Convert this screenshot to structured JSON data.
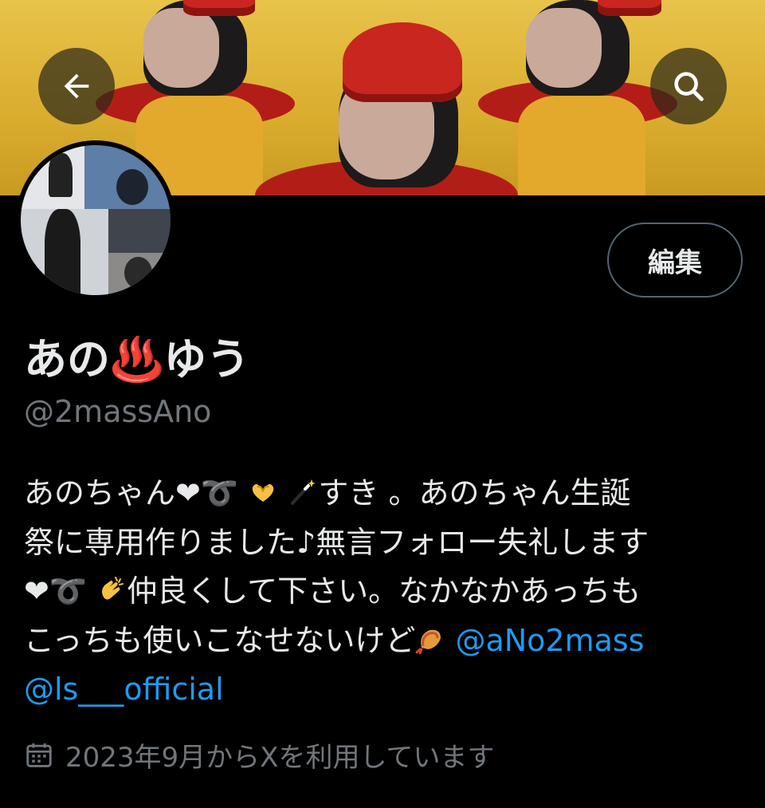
{
  "header": {
    "back_icon": "arrow-left-icon",
    "search_icon": "search-icon",
    "edit_label": "編集"
  },
  "profile": {
    "display_name": "あの♨️ゆう",
    "handle": "@2massAno",
    "bio_lines": {
      "l1_a": "あのちゃん❤︎",
      "l1_b": "すき 。あのちゃん生誕",
      "l2": "祭に専用作りました♪無言フォロー失礼します",
      "l3_b": "仲良くして下さい。なかなかあっちも",
      "l4_a": "こっちも使いこなせないけど",
      "l4_mention": "@aNo2mass",
      "l5_mention": "@ls___official"
    },
    "joined": "2023年9月からXを利用しています",
    "joined_icon": "calendar-icon"
  },
  "colors": {
    "background": "#000000",
    "text": "#e7e9ea",
    "secondary": "#71767b",
    "link": "#1d9bf0",
    "banner": "#d9ad2e"
  }
}
